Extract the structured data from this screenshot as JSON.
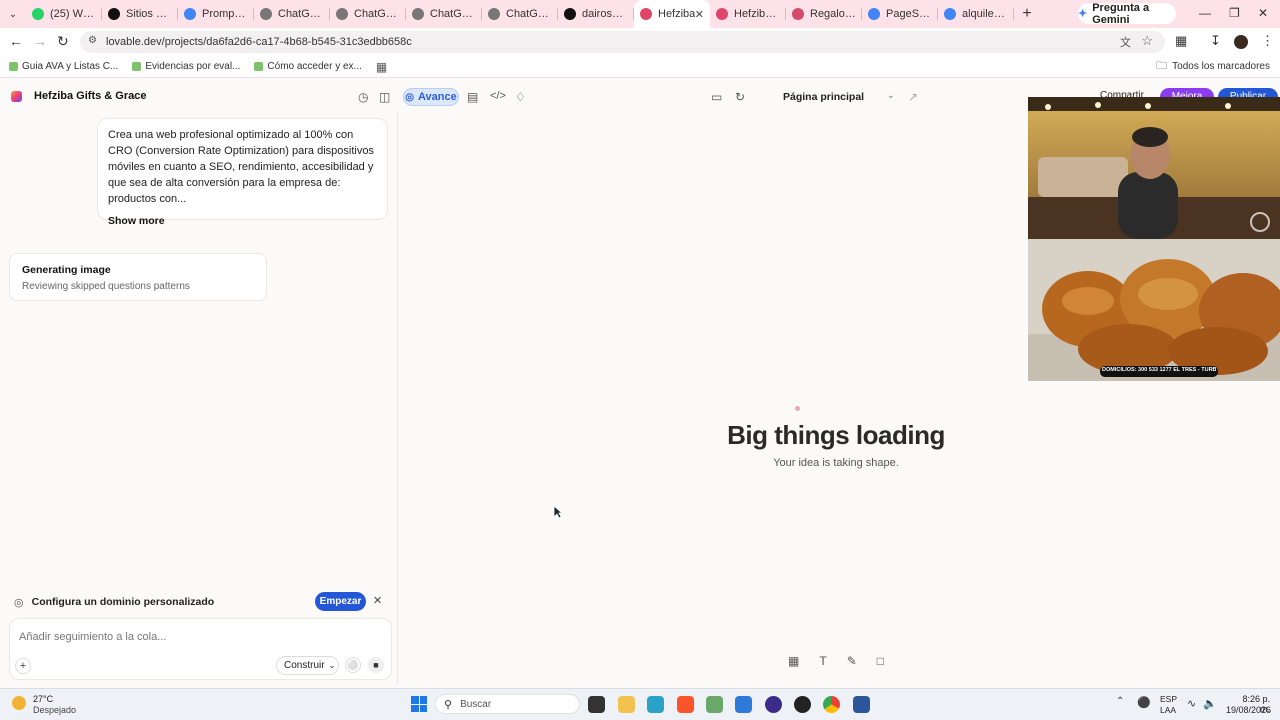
{
  "browser": {
    "tabs": [
      {
        "label": "(25) WhatsA",
        "color": "#25d366"
      },
      {
        "label": "Sitios Webs",
        "color": "#111111"
      },
      {
        "label": "Prompt Sitio",
        "color": "#4285f4"
      },
      {
        "label": "ChatGPT - A",
        "color": "#777777"
      },
      {
        "label": "ChatGPT - S",
        "color": "#777777"
      },
      {
        "label": "ChatGPT - C",
        "color": "#777777"
      },
      {
        "label": "ChatGPT - C",
        "color": "#777777"
      },
      {
        "label": "dairosantos",
        "color": "#111111"
      },
      {
        "label": "Hefziba",
        "color": "#e0466a",
        "active": true
      },
      {
        "label": "Hefziba Gift",
        "color": "#e0466a"
      },
      {
        "label": "Regalos cris",
        "color": "#d64a6b"
      },
      {
        "label": "PageSpeed I",
        "color": "#4285f4"
      },
      {
        "label": "alquiler de a",
        "color": "#4285f4"
      }
    ],
    "gemini_label": "Pregunta a Gemini",
    "url": "lovable.dev/projects/da6fa2d6-ca17-4b68-b545-31c3edbb658c",
    "bookmarks": [
      "Guia AVA y Listas C...",
      "Evidencias por eval...",
      "Cómo acceder y ex..."
    ],
    "all_bookmarks": "Todos los marcadores"
  },
  "app": {
    "project_name": "Hefziba Gifts & Grace",
    "avance_label": "Avance",
    "page_select": "Página principal",
    "share_label": "Compartir",
    "upgrade_label": "Mejora",
    "publish_label": "Publicar"
  },
  "chat": {
    "prompt_text": "Crea una web profesional optimizado al 100% con CRO (Conversion Rate Optimization) para dispositivos móviles en cuanto a SEO, rendimiento, accesibilidad y que sea de alta conversión para la empresa de: productos con...",
    "show_more": "Show more",
    "status_title": "Generating image",
    "status_subtitle": "Reviewing skipped questions patterns",
    "domain_label": "Configura un dominio personalizado",
    "domain_button": "Empezar",
    "composer_placeholder": "Añadir seguimiento a la cola...",
    "build_mode": "Construir"
  },
  "preview": {
    "title": "Big things loading",
    "subtitle": "Your idea is taking shape."
  },
  "overlay": {
    "banner_text": "DOMICILIOS: 300 533 1277 EL TRES - TURBO"
  },
  "taskbar": {
    "weather_temp": "27°C",
    "weather_desc": "Despejado",
    "search_placeholder": "Buscar",
    "lang_line1": "ESP",
    "lang_line2": "LAA",
    "time": "8:26 p. m.",
    "date": "19/08/2026"
  }
}
